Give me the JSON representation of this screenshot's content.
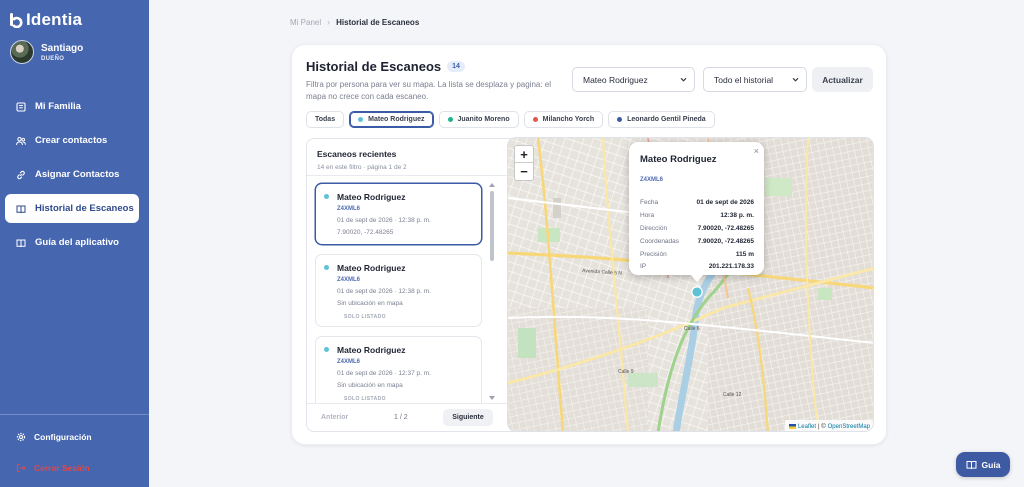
{
  "app": {
    "name": "Identia",
    "logo_icon": "identia-logo-icon"
  },
  "user": {
    "name": "Santiago",
    "role": "DUEÑO"
  },
  "sidebar": {
    "items": [
      {
        "label": "Mi Familia",
        "icon": "home-icon",
        "active": false
      },
      {
        "label": "Crear contactos",
        "icon": "users-icon",
        "active": false
      },
      {
        "label": "Asignar Contactos",
        "icon": "link-icon",
        "active": false
      },
      {
        "label": "Historial de Escaneos",
        "icon": "book-icon",
        "active": true
      },
      {
        "label": "Guía del aplicativo",
        "icon": "book-open-icon",
        "active": false
      }
    ],
    "settings_label": "Configuración",
    "logout_label": "Cerrar Sesión"
  },
  "breadcrumb": {
    "home": "Mi Panel",
    "current": "Historial de Escaneos"
  },
  "card": {
    "title": "Historial de Escaneos",
    "count": "14",
    "description": "Filtra por persona para ver su mapa. La lista se desplaza y pagina: el mapa no crece con cada escaneo.",
    "person_select": "Mateo Rodriguez",
    "range_select": "Todo el historial",
    "update_label": "Actualizar"
  },
  "chips": [
    {
      "label": "Todas",
      "color": "",
      "active": false
    },
    {
      "label": "Mateo Rodriguez",
      "color": "#5fc1d6",
      "active": true
    },
    {
      "label": "Juanito Moreno",
      "color": "#22b38a",
      "active": false
    },
    {
      "label": "Milancho Yorch",
      "color": "#e2574c",
      "active": false
    },
    {
      "label": "Leonardo Gentil Pineda",
      "color": "#3b5ba6",
      "active": false
    }
  ],
  "list": {
    "title": "Escaneos recientes",
    "subtitle": "14 en este filtro · página 1 de 2",
    "items": [
      {
        "name": "Mateo Rodriguez",
        "code": "Z4XML6",
        "date": "01 de sept de 2026 · 12:38 p. m.",
        "extra": "7.90020, -72.48265",
        "tag": ""
      },
      {
        "name": "Mateo Rodriguez",
        "code": "Z4XML6",
        "date": "01 de sept de 2026 · 12:38 p. m.",
        "extra": "Sin ubicación en mapa",
        "tag": "SOLO LISTADO"
      },
      {
        "name": "Mateo Rodriguez",
        "code": "Z4XML6",
        "date": "01 de sept de 2026 · 12:37 p. m.",
        "extra": "Sin ubicación en mapa",
        "tag": "SOLO LISTADO"
      }
    ],
    "prev_label": "Anterior",
    "page_label": "1 / 2",
    "next_label": "Siguiente"
  },
  "map": {
    "zoom_in": "+",
    "zoom_out": "−",
    "popup": {
      "title": "Mateo Rodriguez",
      "code": "Z4XML6",
      "rows": [
        {
          "k": "Fecha",
          "v": "01 de sept de 2026"
        },
        {
          "k": "Hora",
          "v": "12:38 p. m."
        },
        {
          "k": "Dirección",
          "v": "7.90020, -72.48265"
        },
        {
          "k": "Coordenadas",
          "v": "7.90020, -72.48265"
        },
        {
          "k": "Precisión",
          "v": "115 m"
        },
        {
          "k": "IP",
          "v": "201.221.178.33"
        }
      ]
    },
    "street_labels": [
      "Avenida Calle 5 N",
      "Calle 6",
      "Calle 9",
      "Calle 12"
    ],
    "attribution_leaflet": "Leaflet",
    "attribution_sep": "| ©",
    "attribution_osm": "OpenStreetMap"
  },
  "guide_button": {
    "label": "Guía",
    "icon": "book-open-icon"
  }
}
